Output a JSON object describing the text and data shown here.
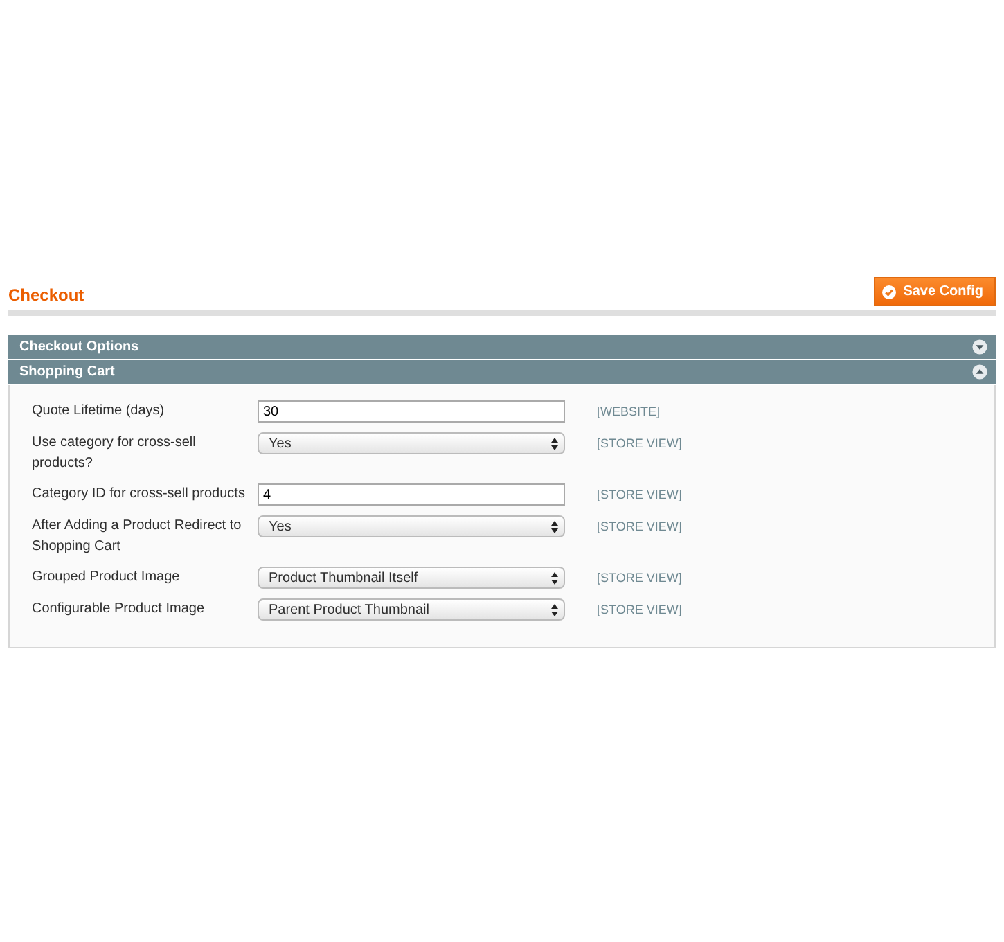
{
  "page_title": "Checkout",
  "save_button": "Save Config",
  "sections": [
    {
      "title": "Checkout Options",
      "expanded": false
    },
    {
      "title": "Shopping Cart",
      "expanded": true,
      "fields": [
        {
          "label": "Quote Lifetime (days)",
          "kind": "text",
          "value": "30",
          "scope": "[WEBSITE]"
        },
        {
          "label": "Use category for cross-sell products?",
          "kind": "select",
          "value": "Yes",
          "scope": "[STORE VIEW]"
        },
        {
          "label": "Category ID for cross-sell products",
          "kind": "text",
          "value": "4",
          "scope": "[STORE VIEW]"
        },
        {
          "label": "After Adding a Product Redirect to Shopping Cart",
          "kind": "select",
          "value": "Yes",
          "scope": "[STORE VIEW]"
        },
        {
          "label": "Grouped Product Image",
          "kind": "select",
          "value": "Product Thumbnail Itself",
          "scope": "[STORE VIEW]"
        },
        {
          "label": "Configurable Product Image",
          "kind": "select",
          "value": "Parent Product Thumbnail",
          "scope": "[STORE VIEW]"
        }
      ]
    }
  ]
}
